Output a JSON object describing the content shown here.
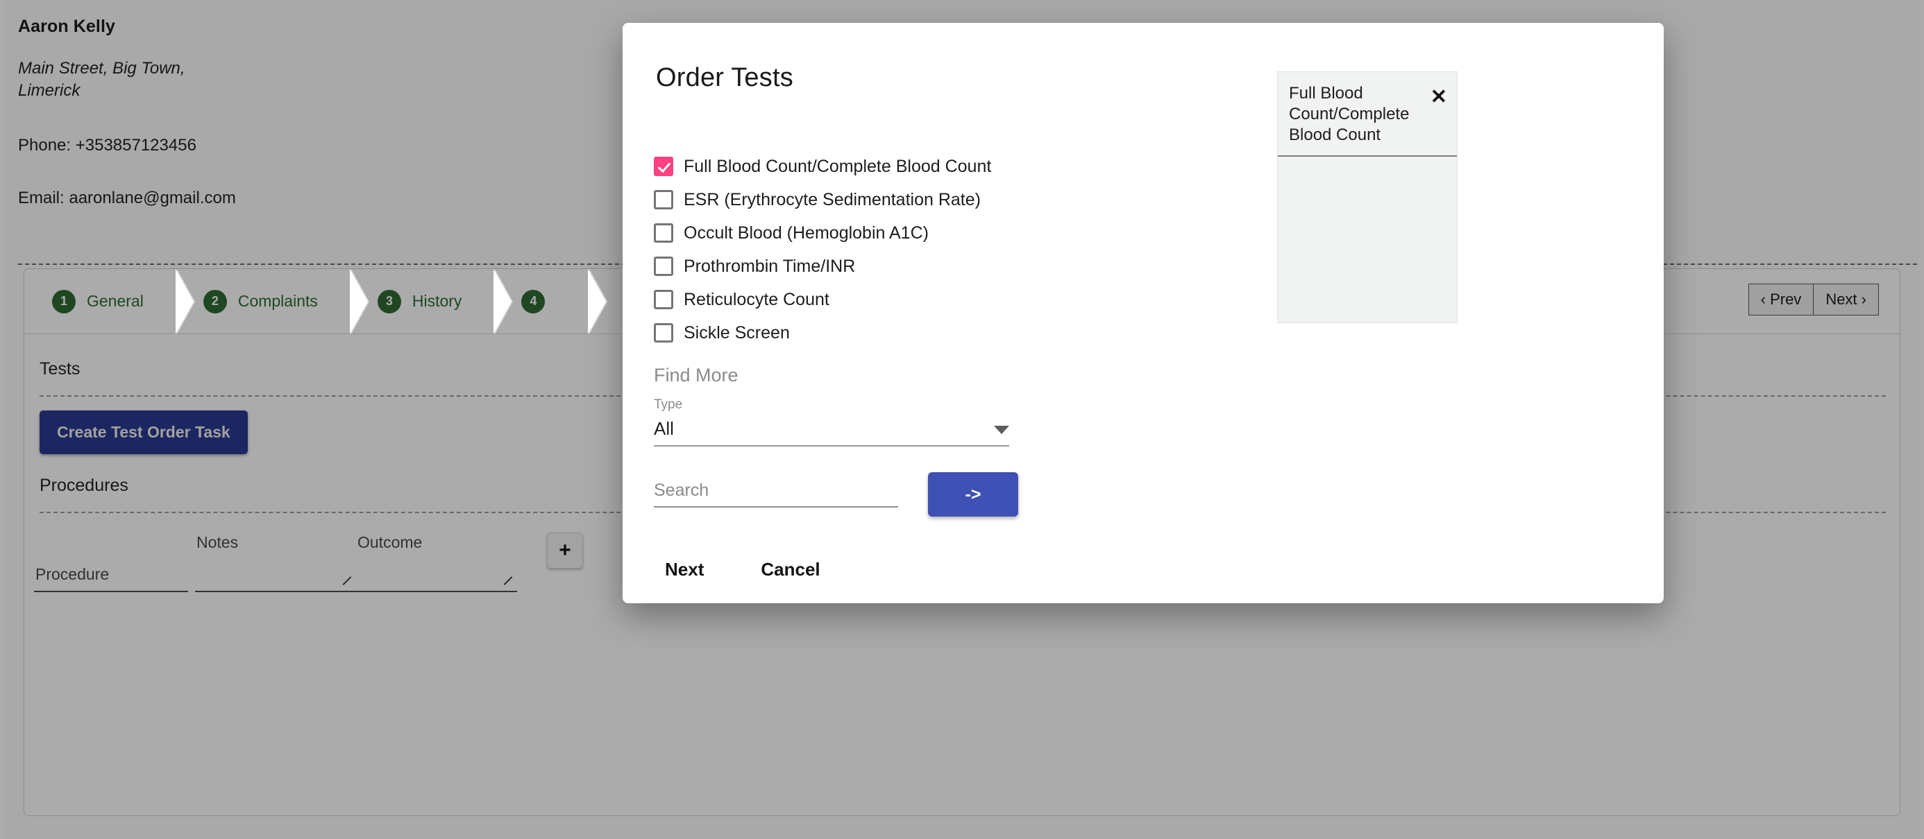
{
  "patient": {
    "name": "Aaron Kelly",
    "address_line1": "Main Street, Big Town,",
    "address_line2": "Limerick",
    "phone": "Phone: +353857123456",
    "email": "Email: aaronlane@gmail.com"
  },
  "stepper": {
    "steps": [
      {
        "number": "1",
        "label": "General"
      },
      {
        "number": "2",
        "label": "Complaints"
      },
      {
        "number": "3",
        "label": "History"
      },
      {
        "number": "4",
        "label": ""
      }
    ],
    "prev_label": "‹ Prev",
    "next_label": "Next ›"
  },
  "sections": {
    "tests_title": "Tests",
    "create_test_order_label": "Create Test Order Task",
    "procedures_title": "Procedures"
  },
  "procedure_row": {
    "procedure_label": "Procedure",
    "notes_label": "Notes",
    "outcome_label": "Outcome",
    "add_label": "+"
  },
  "dialog": {
    "title": "Order Tests",
    "tests": [
      {
        "label": "Full Blood Count/Complete Blood Count",
        "checked": true
      },
      {
        "label": "ESR (Erythrocyte Sedimentation Rate)",
        "checked": false
      },
      {
        "label": "Occult Blood (Hemoglobin A1C)",
        "checked": false
      },
      {
        "label": "Prothrombin Time/INR",
        "checked": false
      },
      {
        "label": "Reticulocyte Count",
        "checked": false
      },
      {
        "label": "Sickle Screen",
        "checked": false
      }
    ],
    "find_more_label": "Find More",
    "type_label": "Type",
    "type_value": "All",
    "search_placeholder": "Search",
    "submit_arrow_label": "->",
    "next_label": "Next",
    "cancel_label": "Cancel",
    "selected": [
      {
        "label": "Full Blood Count/Complete Blood Count",
        "remove_icon": "✕"
      }
    ]
  },
  "colors": {
    "accent_pink": "#FF4081",
    "primary_indigo": "#3F51B5",
    "dark_blue": "#2B3A8F",
    "step_green": "#2E6B33"
  }
}
